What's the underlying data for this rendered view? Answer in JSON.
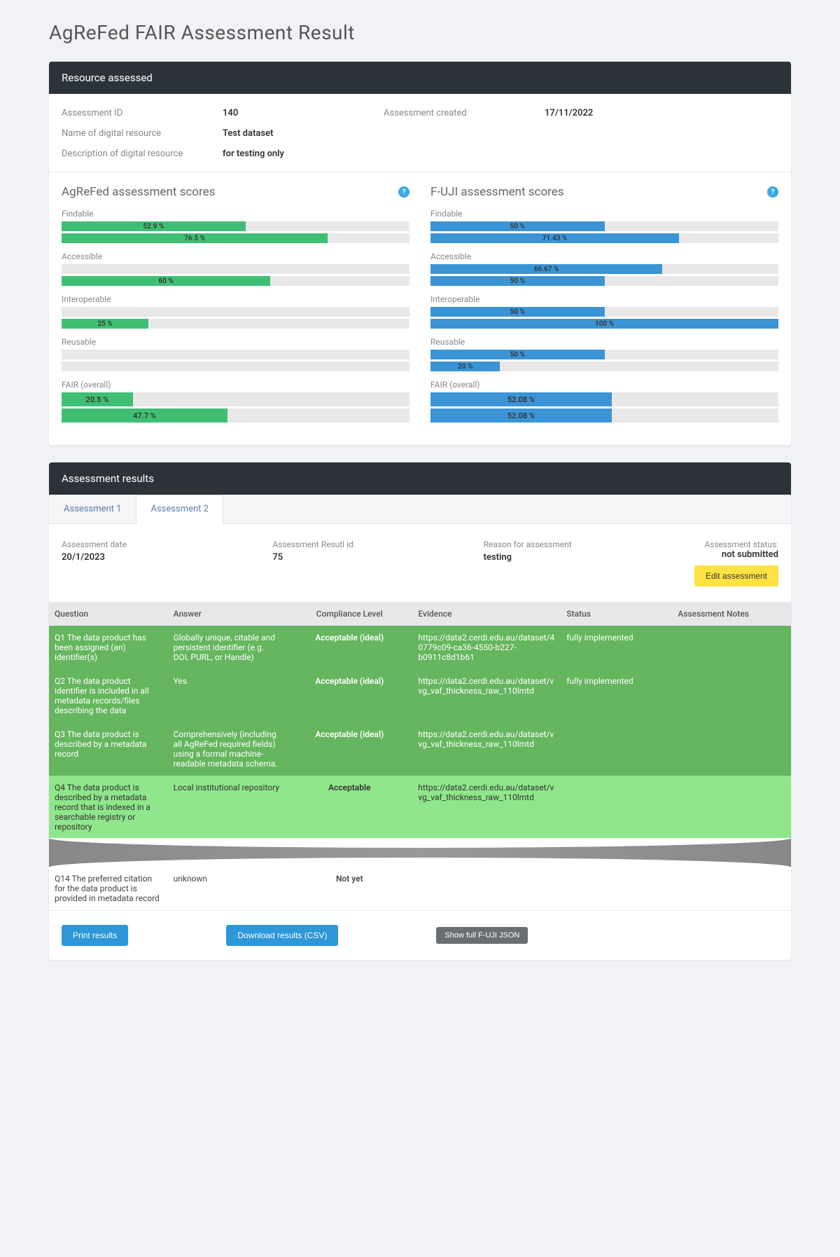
{
  "page_title": "AgReFed FAIR Assessment Result",
  "resource": {
    "header": "Resource assessed",
    "fields": {
      "assessment_id_label": "Assessment ID",
      "assessment_id": "140",
      "created_label": "Assessment created",
      "created": "17/11/2022",
      "name_label": "Name of digital resource",
      "name": "Test dataset",
      "desc_label": "Description of digital resource",
      "desc": "for testing only"
    }
  },
  "scores": {
    "agrefed": {
      "title": "AgReFed assessment scores",
      "groups": [
        {
          "label": "Findable",
          "bars": [
            {
              "pct": 52.9,
              "text": "52.9 %"
            },
            {
              "pct": 76.5,
              "text": "76.5 %"
            }
          ]
        },
        {
          "label": "Accessible",
          "bars": [
            {
              "pct": 0,
              "text": ""
            },
            {
              "pct": 60,
              "text": "60 %"
            }
          ]
        },
        {
          "label": "Interoperable",
          "bars": [
            {
              "pct": 0,
              "text": ""
            },
            {
              "pct": 25,
              "text": "25 %"
            }
          ]
        },
        {
          "label": "Reusable",
          "bars": [
            {
              "pct": 0,
              "text": ""
            },
            {
              "pct": 0,
              "text": ""
            }
          ]
        },
        {
          "label": "FAIR (overall)",
          "overall": true,
          "bars": [
            {
              "pct": 20.5,
              "text": "20.5 %"
            },
            {
              "pct": 47.7,
              "text": "47.7 %"
            }
          ]
        }
      ]
    },
    "fuji": {
      "title": "F-UJI assessment scores",
      "groups": [
        {
          "label": "Findable",
          "bars": [
            {
              "pct": 50,
              "text": "50 %"
            },
            {
              "pct": 71.43,
              "text": "71.43 %"
            }
          ]
        },
        {
          "label": "Accessible",
          "bars": [
            {
              "pct": 66.67,
              "text": "66.67 %"
            },
            {
              "pct": 50,
              "text": "50 %"
            }
          ]
        },
        {
          "label": "Interoperable",
          "bars": [
            {
              "pct": 50,
              "text": "50 %"
            },
            {
              "pct": 100,
              "text": "100 %"
            }
          ]
        },
        {
          "label": "Reusable",
          "bars": [
            {
              "pct": 50,
              "text": "50 %"
            },
            {
              "pct": 20,
              "text": "20 %"
            }
          ]
        },
        {
          "label": "FAIR (overall)",
          "overall": true,
          "bars": [
            {
              "pct": 52.08,
              "text": "52.08 %"
            },
            {
              "pct": 52.08,
              "text": "52.08 %"
            }
          ]
        }
      ]
    }
  },
  "results": {
    "header": "Assessment results",
    "tabs": [
      "Assessment 1",
      "Assessment 2"
    ],
    "meta": {
      "date_label": "Assessment date",
      "date": "20/1/2023",
      "rid_label": "Assessment Resutl id",
      "rid": "75",
      "reason_label": "Reason for assessment",
      "reason": "testing",
      "status_label": "Assessment status:",
      "status": "not submitted",
      "edit_btn": "Edit assessment"
    },
    "columns": [
      "Question",
      "Answer",
      "Compliance Level",
      "Evidence",
      "Status",
      "Assessment Notes"
    ],
    "rows": [
      {
        "style": "dark-green",
        "q": "Q1 The data product has been assigned (an) identifier(s)",
        "a": "Globally unique, citable and persistent identifier (e.g. DOI, PURL, or Handle)",
        "c": "Acceptable (ideal)",
        "e": "https://data2.cerdi.edu.au/dataset/40779c09-ca36-4550-b227-b0911c8d1b61",
        "s": "fully implemented",
        "n": ""
      },
      {
        "style": "dark-green",
        "q": "Q2 The data product identifier is included in all metadata records/files describing the data",
        "a": "Yes",
        "c": "Acceptable (ideal)",
        "e": "https://data2.cerdi.edu.au/dataset/vvg_vaf_thickness_raw_110lmtd",
        "s": "fully implemented",
        "n": ""
      },
      {
        "style": "dark-green",
        "q": "Q3 The data product is described by a metadata record",
        "a": "Comprehensively (including all AgReFed required fields) using a formal machine-readable metadata schema.",
        "c": "Acceptable (ideal)",
        "e": "https://data2.cerdi.edu.au/dataset/vvg_vaf_thickness_raw_110lmtd",
        "s": "",
        "n": ""
      },
      {
        "style": "green",
        "q": "Q4 The data product is described by a metadata record that is indexed in a searchable registry or repository",
        "a": "Local institutional repository",
        "c": "Acceptable",
        "e": "https://data2.cerdi.edu.au/dataset/vvg_vaf_thickness_raw_110lmtd",
        "s": "",
        "n": ""
      }
    ],
    "last_row": {
      "q": "Q14 The preferred citation for the data product is provided in metadata record",
      "a": "unknown",
      "c": "Not yet",
      "e": "",
      "s": "",
      "n": ""
    },
    "buttons": {
      "print": "Print results",
      "csv": "Download results (CSV)",
      "json": "Show full F-UJI JSON"
    }
  }
}
